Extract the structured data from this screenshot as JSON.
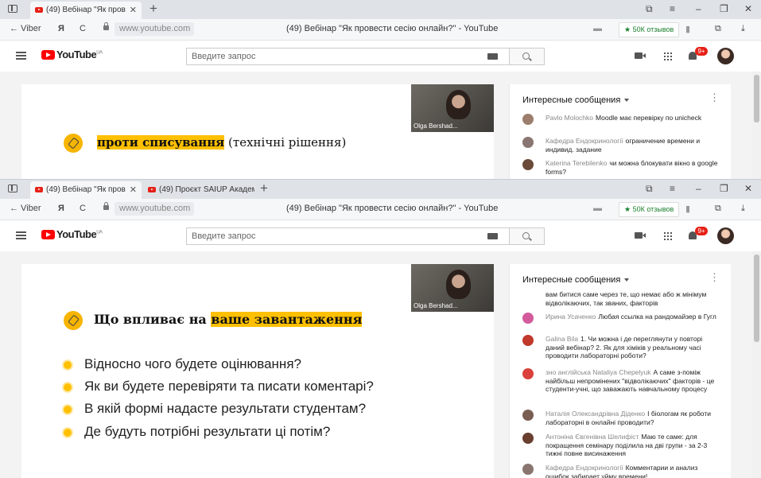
{
  "windowA": {
    "tabs": [
      {
        "title": "(49) Вебінар \"Як пров",
        "active": true
      }
    ],
    "nav": {
      "back_label": "← Viber",
      "ya_label": "Я",
      "refresh_label": "C"
    },
    "address": "www.youtube.com",
    "page_title": "(49) Вебінар \"Як провести сесію онлайн?\" - YouTube",
    "reviews_label": "★ 50К отзывов",
    "youtube": {
      "logo": "YouTube",
      "region": "UA",
      "search_placeholder": "Введите запрос",
      "notif_count": "9+"
    },
    "slide": {
      "pip_name": "Olga Bershad...",
      "heading_highlight": "проти списування",
      "heading_rest": " (технічні рішення)"
    },
    "chat": {
      "header": "Интересные сообщения",
      "messages": [
        {
          "author": "Pavlo Molochko",
          "text": "Moodle має перевірку по unicheck",
          "color": "#9c7e6e"
        },
        {
          "author": "Кафедра Ендокринології",
          "text": "ограничение времени и индивид. задание",
          "color": "#8a7670"
        },
        {
          "author": "Katerina Terebilenko",
          "text": "чи можна блокувати вікно в google forms?",
          "color": "#6b4a3a"
        }
      ]
    }
  },
  "windowB": {
    "tabs": [
      {
        "title": "(49) Вебінар \"Як пров",
        "active": true
      },
      {
        "title": "(49) Проєкт SAIUP Академ",
        "active": false
      }
    ],
    "nav": {
      "back_label": "← Viber",
      "ya_label": "Я",
      "refresh_label": "C"
    },
    "address": "www.youtube.com",
    "page_title": "(49) Вебінар \"Як провести сесію онлайн?\" - YouTube",
    "reviews_label": "★ 50К отзывов",
    "youtube": {
      "logo": "YouTube",
      "region": "UA",
      "search_placeholder": "Введите запрос",
      "notif_count": "9+"
    },
    "slide": {
      "pip_name": "Olga Bershad...",
      "heading_plain": "Що впливає на ",
      "heading_highlight": "ваше завантаження",
      "bullets": [
        "Відносно чого будете оцінювання?",
        "Як ви будете перевіряти та писати коментарі?",
        "В якій формі надасте результати студентам?",
        "Де будуть потрібні результати ці потім?"
      ]
    },
    "chat": {
      "header": "Интересные сообщения",
      "messages": [
        {
          "author": "",
          "text": "вам битися саме через те, що немає або ж мінімум відволікаючих, так званих, факторів",
          "color": ""
        },
        {
          "author": "Ирина Усаченко",
          "text": "Любая ссылка на рандомайзер в Гугл",
          "color": "#d35a9c"
        },
        {
          "author": "Galina Bila",
          "text": "1. Чи можна і де переглянути у повторі даний вебінар? 2. Як для хіміків у реальному часі проводити лабораторні роботи?",
          "color": "#c0392b"
        },
        {
          "author": "зно англійська Nataliya Chepelyuk",
          "text": "А саме з-поміж найбільш непромінених \"відволікаючих\" факторів - це студенти-учні, що заважають навчальному процесу",
          "color": "#d9413a"
        },
        {
          "author": "Наталія Олександрівна Діденко",
          "text": "І біологам як роботи лабораторні в онлайні проводити?",
          "color": "#7a5d52"
        },
        {
          "author": "Антоніна Євгенівна Шелифіст",
          "text": "Маю те саме: для покращення семінару поділила на дві групи - за 2-3 тижні повне висинаження",
          "color": "#6a3f2e"
        },
        {
          "author": "Кафедра Ендокринології",
          "text": "Комментарии и анализ ошибок забирает уйму времени!",
          "color": "#8a7670"
        }
      ]
    }
  }
}
